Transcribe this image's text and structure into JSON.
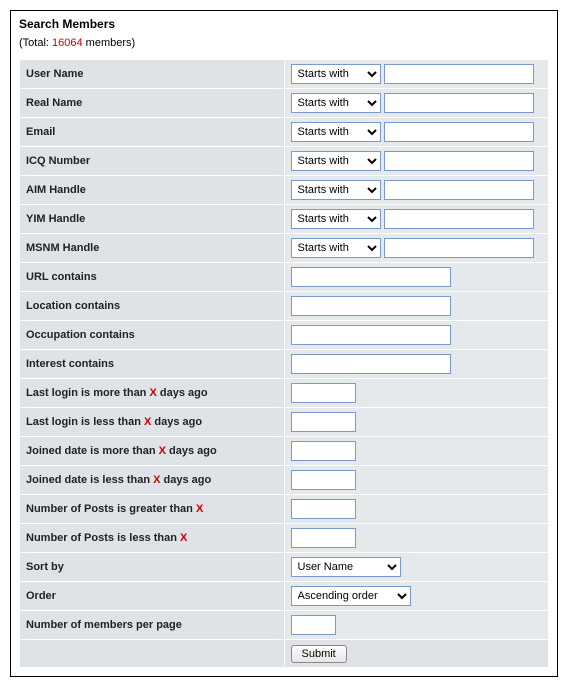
{
  "title": "Search Members",
  "total_prefix": "(Total: ",
  "total_count": "16064",
  "total_suffix": " members)",
  "match_option": "Starts with",
  "rows": {
    "user_name": "User Name",
    "real_name": "Real Name",
    "email": "Email",
    "icq": "ICQ Number",
    "aim": "AIM Handle",
    "yim": "YIM Handle",
    "msnm": "MSNM Handle",
    "url_contains": "URL contains",
    "location_contains": "Location contains",
    "occupation_contains": "Occupation contains",
    "interest_contains": "Interest contains",
    "last_login_more_pre": "Last login is more than ",
    "last_login_more_post": " days ago",
    "last_login_less_pre": "Last login is less than ",
    "last_login_less_post": " days ago",
    "joined_more_pre": "Joined date is more than ",
    "joined_more_post": " days ago",
    "joined_less_pre": "Joined date is less than ",
    "joined_less_post": " days ago",
    "posts_greater_pre": "Number of Posts is greater than ",
    "posts_less_pre": "Number of Posts is less than ",
    "sort_by": "Sort by",
    "order": "Order",
    "per_page": "Number of members per page"
  },
  "x": "X",
  "sort_option": "User Name",
  "order_option": "Ascending order",
  "submit": "Submit"
}
